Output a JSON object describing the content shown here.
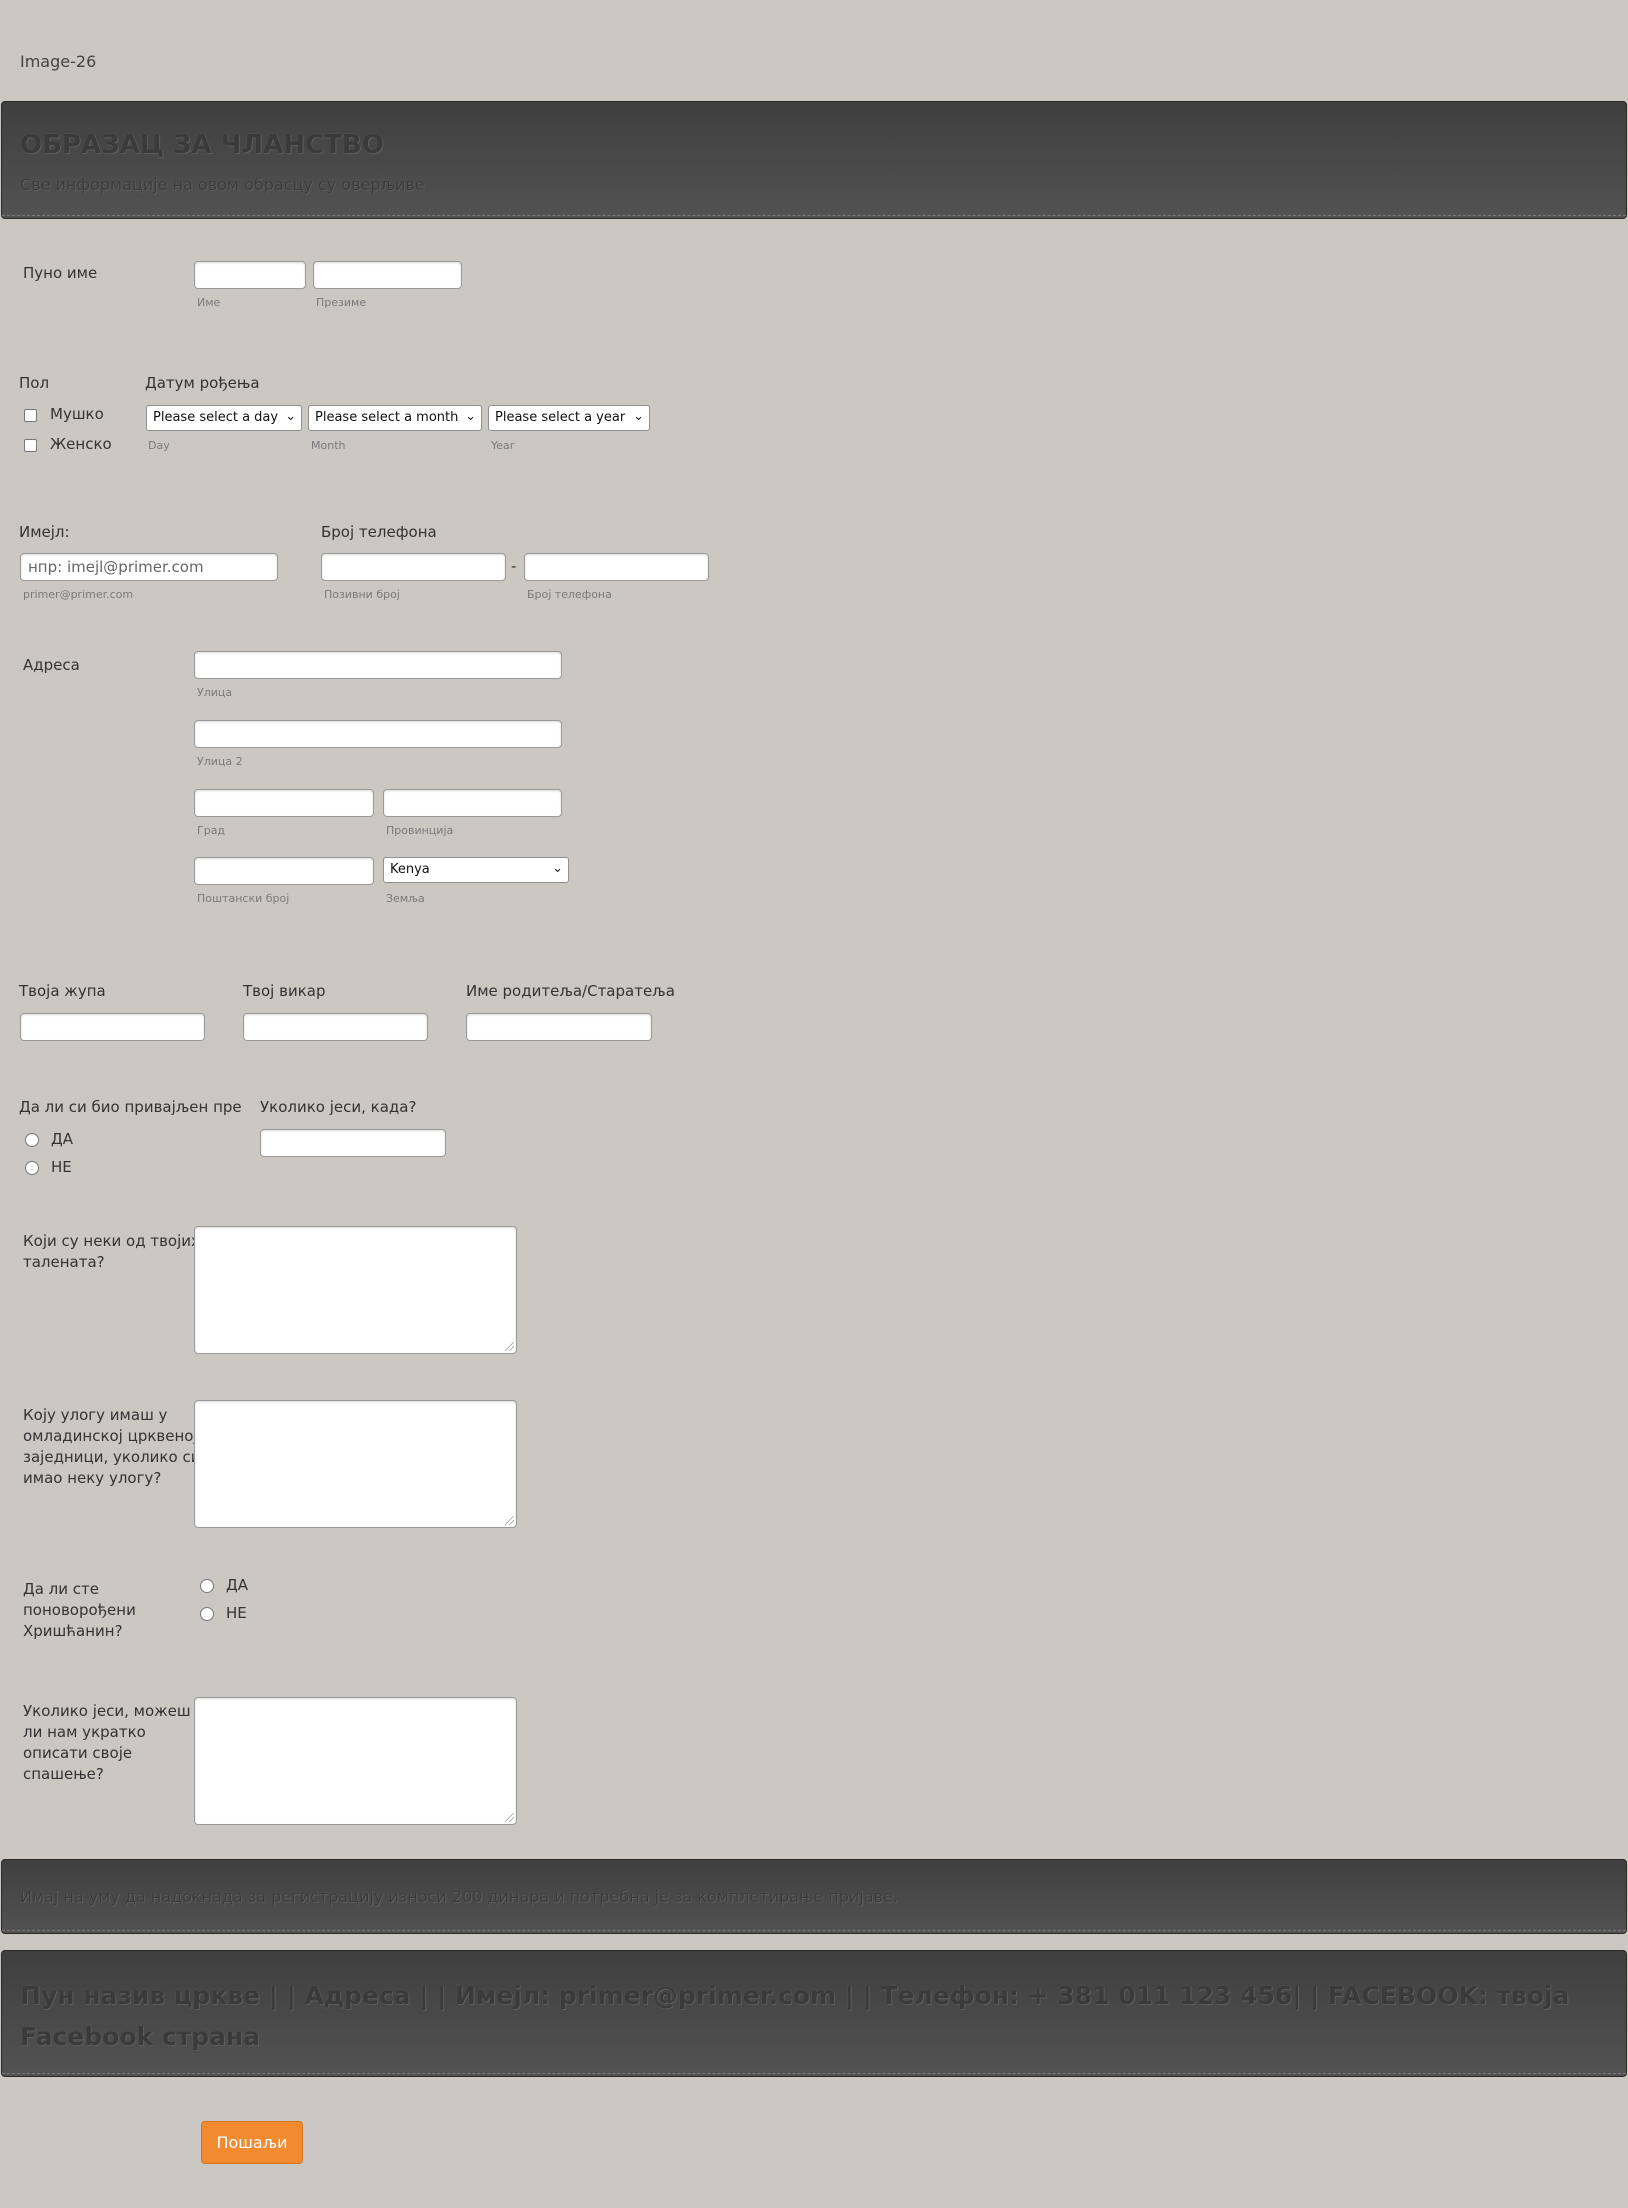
{
  "header_image_alt": "Image-26",
  "header": {
    "title": "ОБРАЗАЦ ЗА ЧЛАНСТВО",
    "subtitle": "Све информације на овом обрасцу су оверљиве"
  },
  "full_name": {
    "label": "Пуно име",
    "first_sublabel": "Име",
    "last_sublabel": "Презиме",
    "first_value": "",
    "last_value": ""
  },
  "gender": {
    "label": "Пол",
    "options": [
      "Мушко",
      "Женско"
    ]
  },
  "birth_date": {
    "label": "Датум рођења",
    "day_value": "Please select a day",
    "month_value": "Please select a month",
    "year_value": "Please select a year",
    "day_sublabel": "Day",
    "month_sublabel": "Month",
    "year_sublabel": "Year"
  },
  "email": {
    "label": "Имејл:",
    "placeholder": "нпр: imejl@primer.com",
    "sublabel": "primer@primer.com"
  },
  "phone": {
    "label": "Број телефона",
    "separator": "-",
    "area_sublabel": "Позивни број",
    "number_sublabel": "Број телефона"
  },
  "address": {
    "label": "Адреса",
    "street_sublabel": "Улица",
    "street2_sublabel": "Улица 2",
    "city_sublabel": "Град",
    "province_sublabel": "Провинција",
    "zip_sublabel": "Поштански број",
    "country_sublabel": "Земља",
    "country_value": "Kenya"
  },
  "parish": {
    "label": "Твоја жупа"
  },
  "vicar": {
    "label": "Твој викар"
  },
  "guardian": {
    "label": "Име родитеља/Старатеља"
  },
  "confirmed": {
    "label": "Да ли си био привајљен пре",
    "options": [
      "ДА",
      "НЕ"
    ]
  },
  "when": {
    "label": "Уколико јеси, када?"
  },
  "talents": {
    "label_lines": [
      "Који су неки од твојих",
      "талената?"
    ]
  },
  "role": {
    "label_lines": [
      "Коју улогу имаш у",
      "омладинској црквеној",
      "заједници, уколико си",
      "имао неку улогу?"
    ]
  },
  "born_again": {
    "label_lines": [
      "Да ли сте",
      "поноворођени",
      "Хришћанин?"
    ],
    "options": [
      "ДА",
      "НЕ"
    ]
  },
  "salvation": {
    "label_lines": [
      "Уколико јеси, можеш",
      "ли нам укратко",
      "описати своје",
      "спашење?"
    ]
  },
  "notice": "Имај на уму да надокнада за регистрацију износи 200 динара и потребна је за комплетирање пријаве.",
  "footer_lines": [
    "Пун назив цркве | | Адреса | | Имејл: primer@primer.com | | Телефон: + 381 011 123 456| | FACEBOOK: твоја",
    "Facebook страна"
  ],
  "submit_label": "Пошаљи"
}
